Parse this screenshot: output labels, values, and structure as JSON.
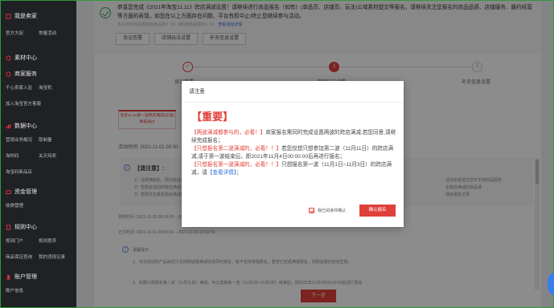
{
  "sidebar": {
    "sections": [
      {
        "title": "我是卖家",
        "icon": "seller-icon",
        "items": [
          "官方大促",
          "常量活动"
        ]
      },
      {
        "title": "素材中心",
        "icon": "material-icon",
        "items": []
      },
      {
        "title": "商家服务",
        "icon": "service-icon",
        "items": [
          "千心卖家入驻",
          "淘宝机",
          "加入淘宝官方客服"
        ]
      },
      {
        "title": "数据中心",
        "icon": "data-icon",
        "items": [
          "营销业务概况",
          "取制量",
          "淘时码",
          "关天持卖",
          "淘宝码新品店"
        ]
      },
      {
        "title": "资金管理",
        "icon": "wallet-icon",
        "items": [
          "收费管理"
        ]
      },
      {
        "title": "规则中心",
        "icon": "rules-icon",
        "items": [
          "规则门户",
          "规则意序",
          "商品保证查询",
          "我的违规记录"
        ]
      },
      {
        "title": "账户管理",
        "icon": "account-icon",
        "items": [
          "账户信息"
        ]
      }
    ]
  },
  "notice": {
    "text": "恭喜您完成《2021年淘宝11.11》跨店满减设置！请继续进行商品报名（如有）(单品页、店铺页、玩法)公域素材提交等报名，请继续关注您报名的商品品质、店铺服务、履约经营等方面的表现，如您在以上方面存在问题，平台有权中止/终止您继续参与活动。",
    "sub_prefix": "本次活动可提报现金商品的3（0）(种)最低提报0%（0）",
    "sub_link": "查看活动详情",
    "buttons": [
      "协议签署",
      "店铺玩法设置",
      "补充信息设置"
    ]
  },
  "steps": [
    {
      "label": "协议签署",
      "state": "done"
    },
    {
      "label": "店铺玩法设置",
      "state": "active",
      "num": "2"
    },
    {
      "label": "补充信息设置",
      "state": "todo",
      "num": "3"
    }
  ],
  "red_tab": {
    "line1": "淘宝11.11第一波跨店满减(必选)",
    "line2": "审核通过"
  },
  "activity_time": "活动时间: 2021-11-01 00:00",
  "notice_label": "【请注意】:",
  "info_lines": [
    "1）请报满额后，预先跨店满减活动的",
    "2）若跨店活动时跨店满减",
    "3）若您仅在报名跨店满减时"
  ],
  "info_right": [
    "活动未报请过您不支持商品服务",
    "全跨店满减的商品或",
    "通进报名记录"
  ],
  "warm_time": "预热时间: 2021-10-29 00:00:00 – 2021-10-31 23:59:59",
  "formal_time": "正式时间: 2021-11-01 00:00:00 – 2021-11-03 23:59:59",
  "tips": {
    "title": "温馨提示:",
    "line1": "1、本次活动的产品目前只支持跨店报满减玩法同时报名，暂不支持单独报名，若您已完成满减报名，则跨店报均自动生效。",
    "line2": "2、如果只想报名第二波（11月11日）满减，可以直接第一波（11月1日~11月3日）结束后，即2021年11月4日00:00:00后进行报名"
  },
  "next_button": "下一步",
  "modal": {
    "header": "请注意",
    "title": "【重要】",
    "p1_red": "【两波满减都参与的，必看！】",
    "p1": "商家报名需同时完成设置两波的跨店满减,若您同意,请继续完成报名；",
    "p2_red": "【只想报名第二波满减的，必看！！】",
    "p2": "若您仅想只想参加第二波（11月11日）的跨店满减,请于第一波结束后，即2021年11月4日00:00:00后再进行报名；",
    "p3_red": "【只想报名第一波满减的，必看！！】",
    "p3": "只想报名第一波（11月1日~11月3日）的跨店满减，请",
    "p3_link": "【查看详情】",
    "p3_end": "；",
    "checkbox_label": "我已阅读并确认",
    "confirm_button": "确认报名"
  }
}
